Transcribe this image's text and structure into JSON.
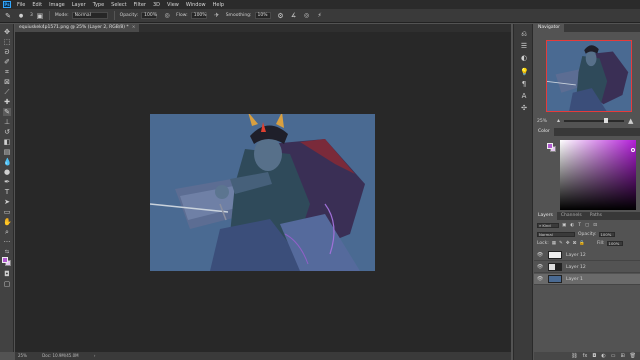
{
  "app": {
    "logo": "Ps"
  },
  "menu": [
    "File",
    "Edit",
    "Image",
    "Layer",
    "Type",
    "Select",
    "Filter",
    "3D",
    "View",
    "Window",
    "Help"
  ],
  "options": {
    "brush_size": "3",
    "mode_label": "Mode:",
    "mode_value": "Normal",
    "opacity_label": "Opacity:",
    "opacity_value": "100%",
    "flow_label": "Flow:",
    "flow_value": "100%",
    "smoothing_label": "Smoothing:",
    "smoothing_value": "10%"
  },
  "document": {
    "tab_title": "equiuskek4p1571.png @ 25% (Layer 2, RGB/8) *",
    "close_glyph": "×"
  },
  "status": {
    "zoom": "25%",
    "doc_info": "Doc: 10.9M/45.0M",
    "arrow": "›"
  },
  "navigator": {
    "tab": "Navigator",
    "zoom": "25%"
  },
  "color_panel": {
    "tab": "Color"
  },
  "layers_panel": {
    "tabs": [
      "Layers",
      "Channels",
      "Paths"
    ],
    "kind_label": "Kind",
    "blend_mode": "Normal",
    "opacity_label": "Opacity:",
    "opacity_value": "100%",
    "lock_label": "Lock:",
    "fill_label": "Fill:",
    "fill_value": "100%",
    "layers": [
      {
        "name": "Layer 12",
        "selected": false
      },
      {
        "name": "Layer 12",
        "selected": false
      },
      {
        "name": "Layer 1",
        "selected": true
      }
    ]
  },
  "colors": {
    "foreground": "#b05ad0",
    "background": "#e4c9ef",
    "canvas_bg": "#4a6a92",
    "accent": "#31a8ff"
  },
  "icons": {
    "tools": [
      "move-icon",
      "marquee-icon",
      "lasso-icon",
      "quick-select-icon",
      "crop-icon",
      "frame-icon",
      "eyedropper-icon",
      "healing-icon",
      "brush-icon",
      "clone-stamp-icon",
      "history-brush-icon",
      "eraser-icon",
      "gradient-icon",
      "blur-icon",
      "dodge-icon",
      "pen-icon",
      "type-icon",
      "path-select-icon",
      "shape-icon",
      "hand-icon",
      "zoom-icon",
      "more-icon"
    ]
  }
}
